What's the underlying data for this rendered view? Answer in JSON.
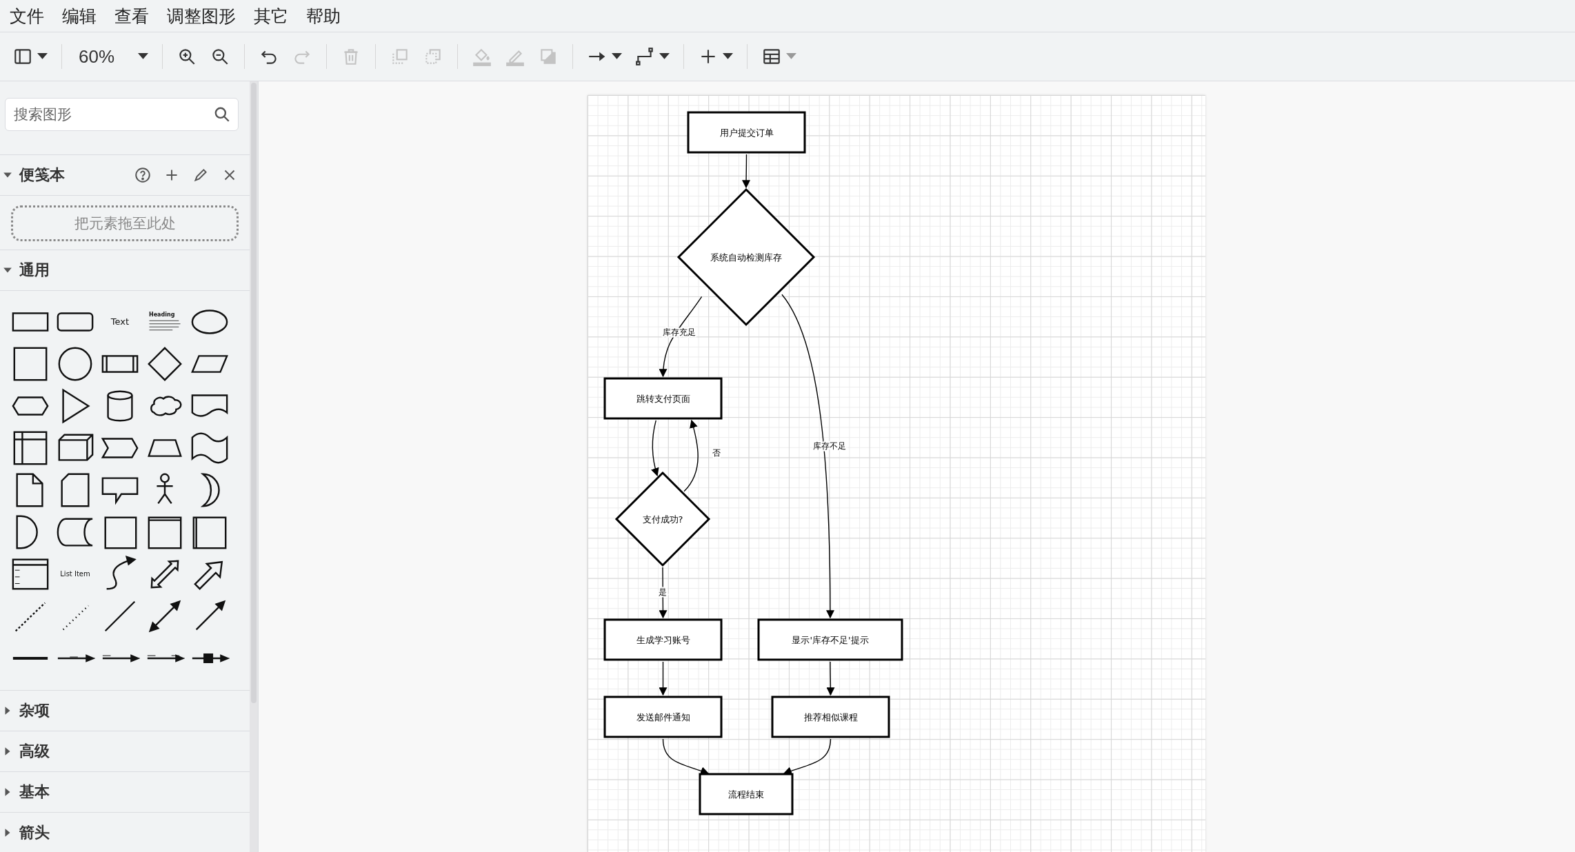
{
  "menu": [
    "文件",
    "编辑",
    "查看",
    "调整图形",
    "其它",
    "帮助"
  ],
  "toolbar": {
    "groups": [
      {
        "tools": [
          {
            "kind": "panel",
            "disabled": false,
            "menu": true
          }
        ]
      },
      {
        "tools": [
          {
            "kind": "zoom",
            "text": "60%",
            "disabled": false,
            "menu": true
          }
        ]
      },
      {
        "tools": [
          {
            "kind": "zoom-in",
            "disabled": false,
            "menu": false
          },
          {
            "kind": "zoom-out",
            "disabled": false,
            "menu": false
          }
        ]
      },
      {
        "tools": [
          {
            "kind": "undo",
            "disabled": false,
            "menu": false
          },
          {
            "kind": "redo",
            "disabled": true,
            "menu": false
          }
        ]
      },
      {
        "tools": [
          {
            "kind": "delete",
            "disabled": true,
            "menu": false
          }
        ]
      },
      {
        "tools": [
          {
            "kind": "front",
            "disabled": true,
            "menu": false
          },
          {
            "kind": "back",
            "disabled": true,
            "menu": false
          }
        ]
      },
      {
        "tools": [
          {
            "kind": "fill",
            "disabled": true,
            "menu": false
          },
          {
            "kind": "stroke",
            "disabled": true,
            "menu": false
          },
          {
            "kind": "shadow",
            "disabled": true,
            "menu": false
          }
        ]
      },
      {
        "tools": [
          {
            "kind": "connection",
            "disabled": false,
            "menu": true
          },
          {
            "kind": "waypoint",
            "disabled": false,
            "menu": true
          }
        ]
      },
      {
        "tools": [
          {
            "kind": "insert",
            "disabled": false,
            "menu": true
          }
        ]
      },
      {
        "tools": [
          {
            "kind": "table",
            "disabled": false,
            "menu": true
          }
        ]
      }
    ]
  },
  "sidebar": {
    "search": {
      "placeholder": "搜索图形"
    },
    "scratchpad": {
      "title": "便笺本",
      "expanded": true,
      "drop_hint": "把元素拖至此处"
    },
    "general": {
      "title": "通用",
      "expanded": true,
      "texts": [
        "Text",
        "Heading",
        "List Item"
      ]
    },
    "sections": [
      {
        "title": "杂项",
        "expanded": false
      },
      {
        "title": "高级",
        "expanded": false
      },
      {
        "title": "基本",
        "expanded": false
      },
      {
        "title": "箭头",
        "expanded": false
      }
    ]
  },
  "diagram": {
    "nodes": [
      {
        "kind": "rect",
        "label": "用户提交订单"
      },
      {
        "kind": "diamond",
        "label": "系统自动检测库存"
      },
      {
        "kind": "rect",
        "label": "跳转支付页面"
      },
      {
        "kind": "diamond",
        "label": "支付成功?"
      },
      {
        "kind": "rect",
        "label": "生成学习账号"
      },
      {
        "kind": "rect",
        "label": "显示'库存不足'提示"
      },
      {
        "kind": "rect",
        "label": "发送邮件通知"
      },
      {
        "kind": "rect",
        "label": "推荐相似课程"
      },
      {
        "kind": "rect",
        "label": "流程结束"
      }
    ],
    "edge_labels": [
      "库存充足",
      "库存不足",
      "否",
      "是"
    ]
  }
}
